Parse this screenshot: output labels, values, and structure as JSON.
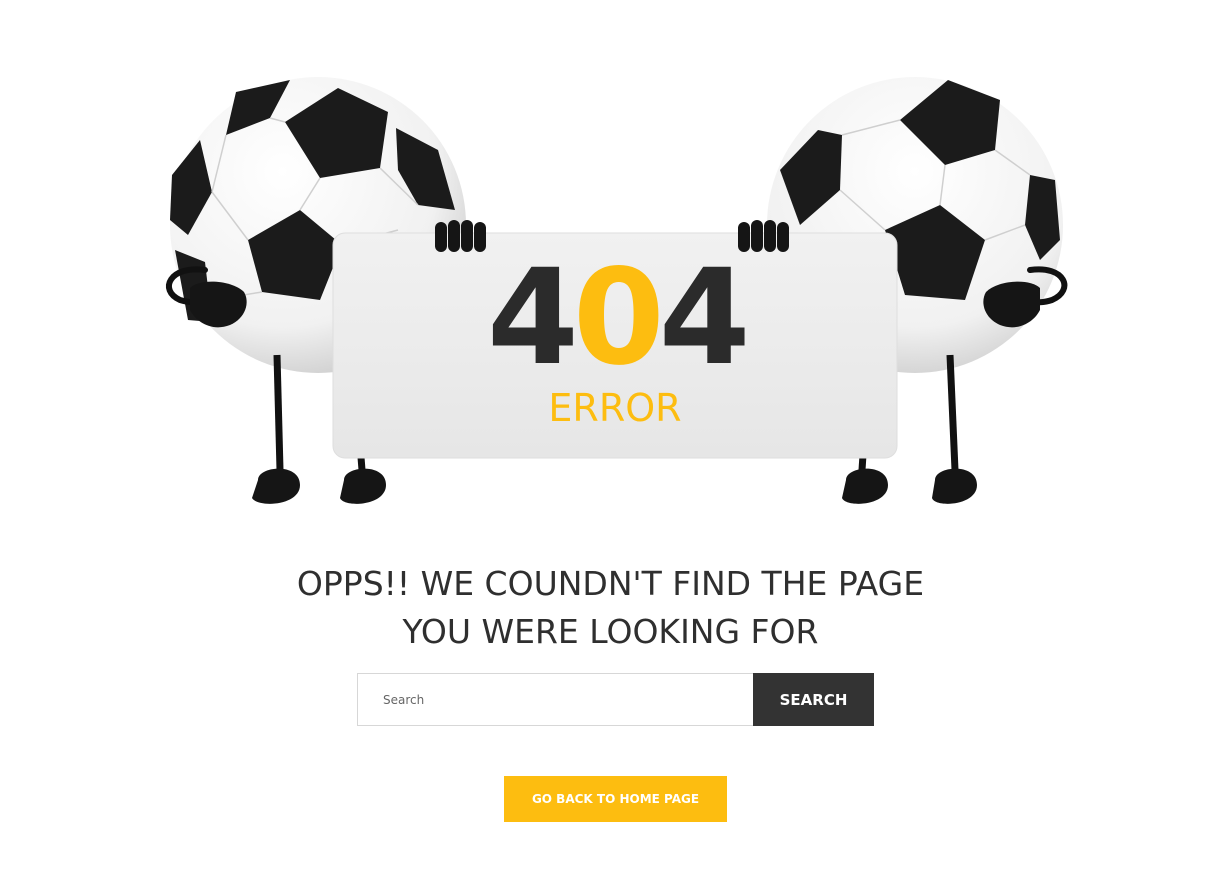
{
  "hero": {
    "code_left": "4",
    "code_middle": "0",
    "code_right": "4",
    "error_word": "ERROR"
  },
  "message": {
    "line1": "OPPS!! WE COUNDN'T FIND THE PAGE",
    "line2": "YOU WERE LOOKING FOR"
  },
  "search": {
    "placeholder": "Search",
    "value": "",
    "button_label": "SEARCH"
  },
  "home_button": {
    "label": "GO BACK TO HOME PAGE"
  },
  "colors": {
    "accent": "#fdbd10",
    "dark": "#333333",
    "text": "#2f2f2f"
  }
}
